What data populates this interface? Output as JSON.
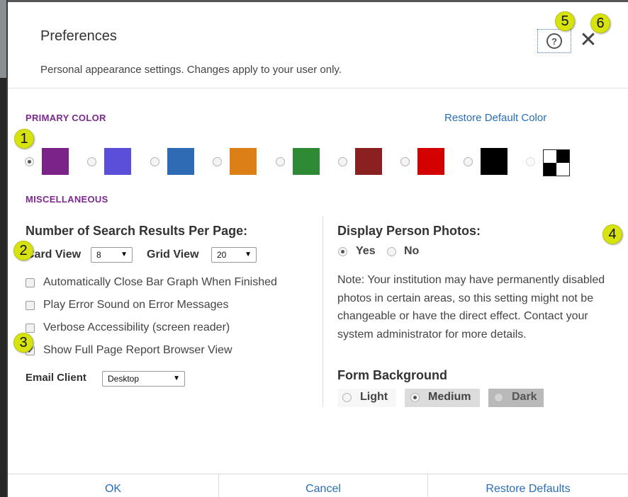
{
  "dialog": {
    "title": "Preferences",
    "subtitle": "Personal appearance settings. Changes apply to your user only.",
    "help_icon": "question-circle-icon",
    "help_glyph": "?",
    "close_glyph": "✕"
  },
  "callouts": [
    "1",
    "2",
    "3",
    "4",
    "5",
    "6"
  ],
  "primary_color": {
    "label": "PRIMARY COLOR",
    "restore_label": "Restore Default Color",
    "swatches": [
      {
        "color": "#7b2388",
        "selected": true
      },
      {
        "color": "#5b4fd9",
        "selected": false
      },
      {
        "color": "#2f6ab5",
        "selected": false
      },
      {
        "color": "#dc7f16",
        "selected": false
      },
      {
        "color": "#2f8a36",
        "selected": false
      },
      {
        "color": "#8b2020",
        "selected": false
      },
      {
        "color": "#d50000",
        "selected": false
      },
      {
        "color": "#000000",
        "selected": false
      },
      {
        "color": "checkerboard",
        "selected": false
      }
    ]
  },
  "misc": {
    "label": "MISCELLANEOUS",
    "results_heading": "Number of Search Results Per Page:",
    "card_view_label": "Card View",
    "card_view_value": "8",
    "grid_view_label": "Grid View",
    "grid_view_value": "20",
    "checkboxes": [
      {
        "label": "Automatically Close Bar Graph When Finished",
        "checked": false
      },
      {
        "label": "Play Error Sound on Error Messages",
        "checked": false
      },
      {
        "label": "Verbose Accessibility (screen reader)",
        "checked": false
      },
      {
        "label": "Show Full Page Report Browser View",
        "checked": true
      }
    ],
    "email_client_label": "Email Client",
    "email_client_value": "Desktop"
  },
  "photos": {
    "heading": "Display Person Photos:",
    "yes_label": "Yes",
    "no_label": "No",
    "selected": "Yes",
    "note": "Note: Your institution may have permanently disabled photos in certain areas, so this setting might not be changeable or have the direct effect. Contact your system administrator for more details."
  },
  "form_background": {
    "heading": "Form Background",
    "options": [
      "Light",
      "Medium",
      "Dark"
    ],
    "selected": "Medium"
  },
  "footer": {
    "ok_label": "OK",
    "cancel_label": "Cancel",
    "restore_defaults_label": "Restore Defaults"
  },
  "colors": {
    "accent_purple": "#7b2a8c",
    "link_blue": "#2a6eb8",
    "callout_yellow": "#d6e30f"
  }
}
